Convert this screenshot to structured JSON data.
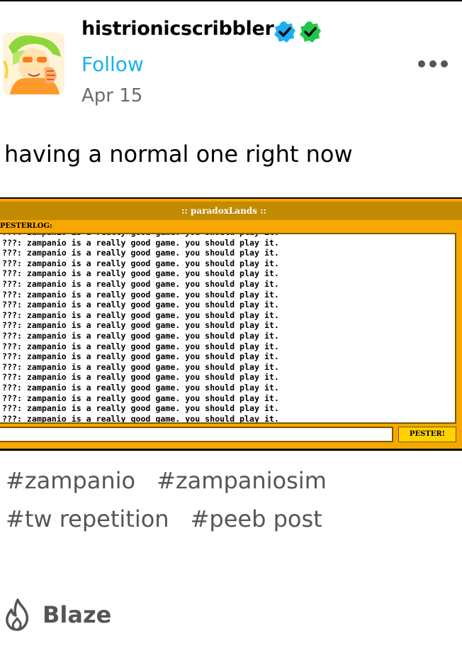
{
  "post": {
    "username": "histrionicscribbler",
    "follow_label": "Follow",
    "date": "Apr 15",
    "caption": "having a normal one right now"
  },
  "pesterlog": {
    "title": ":: paradoxLands ::",
    "log_label": "PESTERLOG:",
    "lines": [
      "???: zampanio is a really good game. you should play it.",
      "???: zampanio is a really good game. you should play it.",
      "???: zampanio is a really good game. you should play it.",
      "???: zampanio is a really good game. you should play it.",
      "???: zampanio is a really good game. you should play it.",
      "???: zampanio is a really good game. you should play it.",
      "???: zampanio is a really good game. you should play it.",
      "???: zampanio is a really good game. you should play it.",
      "???: zampanio is a really good game. you should play it.",
      "???: zampanio is a really good game. you should play it.",
      "???: zampanio is a really good game. you should play it.",
      "???: zampanio is a really good game. you should play it.",
      "???: zampanio is a really good game. you should play it.",
      "???: zampanio is a really good game. you should play it.",
      "???: zampanio is a really good game. you should play it.",
      "???: zampanio is a really good game. you should play it.",
      "???: zampanio is a really good game. you should play it.",
      "???: zampanio is a really good game. you should play it.",
      "???: zampanio is a really good game. you should play it."
    ],
    "input_value": "",
    "button_label": "PESTER!"
  },
  "tags": {
    "row1": [
      "#zampanio",
      "#zampaniosim"
    ],
    "row2": [
      "#tw repetition",
      "#peeb post"
    ]
  },
  "blaze": {
    "label": "Blaze"
  },
  "icons": {
    "verified_blue": "verified-badge-icon",
    "verified_green": "verified-badge-icon",
    "more": "more-options-icon",
    "blaze": "flame-icon"
  },
  "colors": {
    "follow": "#1ab0f2",
    "badge_blue": "#1ab0f2",
    "badge_green": "#1ec74a",
    "pester_bg": "#f7a800",
    "pester_title_bg": "#c28a00"
  }
}
